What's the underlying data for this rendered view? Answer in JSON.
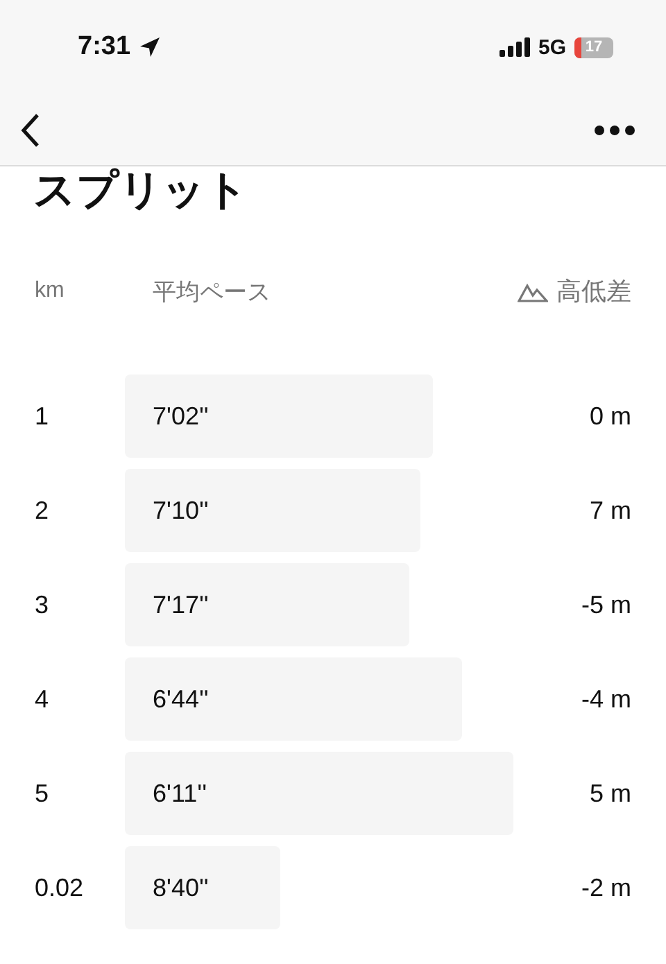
{
  "status_bar": {
    "time": "7:31",
    "network": "5G",
    "battery": "17"
  },
  "title": "スプリット",
  "columns": {
    "km": "km",
    "pace": "平均ペース",
    "elevation": "高低差"
  },
  "splits": [
    {
      "km": "1",
      "pace": "7'02''",
      "elevation": "0 m"
    },
    {
      "km": "2",
      "pace": "7'10''",
      "elevation": "7 m"
    },
    {
      "km": "3",
      "pace": "7'17''",
      "elevation": "-5 m"
    },
    {
      "km": "4",
      "pace": "6'44''",
      "elevation": "-4 m"
    },
    {
      "km": "5",
      "pace": "6'11''",
      "elevation": "5 m"
    },
    {
      "km": "0.02",
      "pace": "8'40''",
      "elevation": "-2 m"
    }
  ]
}
